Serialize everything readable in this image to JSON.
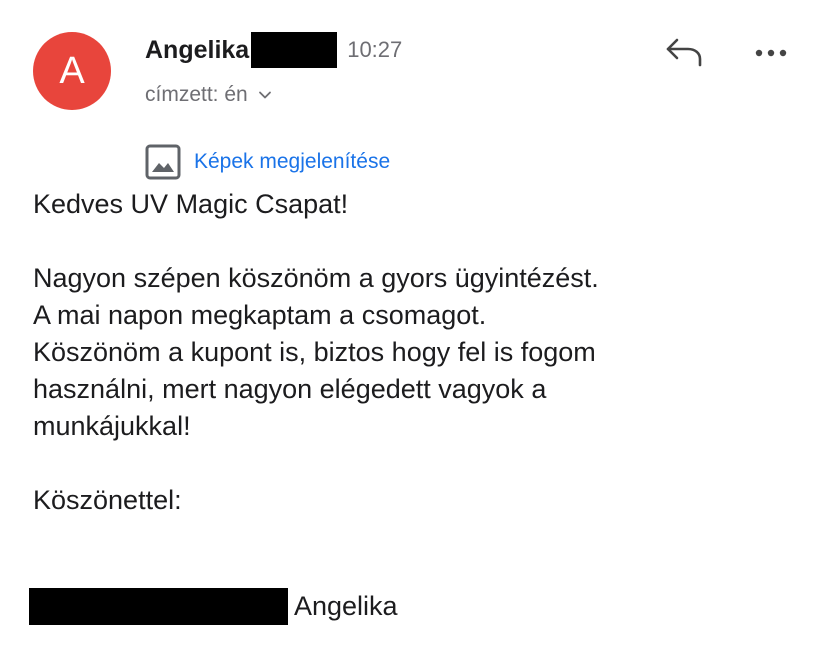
{
  "sender": {
    "avatar_letter": "A",
    "avatar_color": "#e8453c",
    "name": "Angelika",
    "time": "10:27"
  },
  "recipient": {
    "label": "címzett: én"
  },
  "actions": {
    "reply_icon": "reply-icon",
    "more_icon": "more-horizontal-icon"
  },
  "show_images": {
    "icon": "image-icon",
    "label": "Képek megjelenítése",
    "color": "#1a73e8"
  },
  "message": {
    "greeting": "Kedves UV Magic Csapat!",
    "paragraph_lines": [
      "Nagyon szépen köszönöm a gyors ügyintézést.",
      "A mai napon megkaptam a csomagot.",
      "Köszönöm a kupont is, biztos hogy fel is fogom",
      "használni, mert nagyon elégedett vagyok a",
      "munkájukkal!"
    ],
    "closing": "Köszönettel:",
    "signature_name": "Angelika"
  }
}
